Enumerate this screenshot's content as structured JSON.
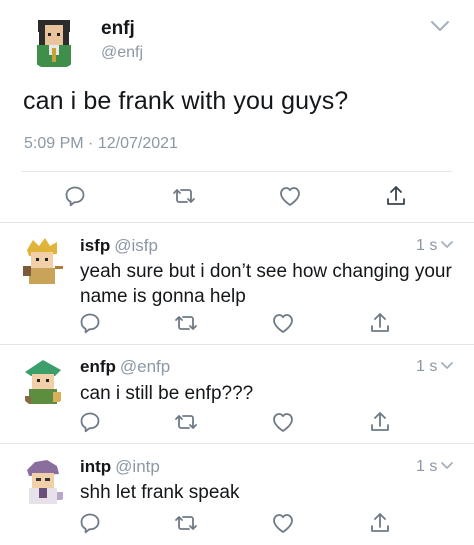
{
  "main_tweet": {
    "author_name": "enfj",
    "author_handle": "@enfj",
    "text": "can i be frank with you guys?",
    "time": "5:09 PM",
    "separator": "·",
    "date": "12/07/2021",
    "avatar_icon": "pixel-person-avatar",
    "menu_icon": "chevron-down-icon"
  },
  "actions": {
    "reply_icon": "reply-icon",
    "retweet_icon": "retweet-icon",
    "like_icon": "heart-icon",
    "share_icon": "share-icon"
  },
  "replies": [
    {
      "name": "isfp",
      "handle": "@isfp",
      "time": "1 s",
      "text_line1": "yeah sure but i don’t see how changing your",
      "text_line2": "name is gonna help",
      "avatar_icon": "adventurer-avatar"
    },
    {
      "name": "enfp",
      "handle": "@enfp",
      "time": "1 s",
      "text_line1": "can i still be enfp???",
      "avatar_icon": "campaigner-avatar"
    },
    {
      "name": "intp",
      "handle": "@intp",
      "time": "1 s",
      "text_line1": "shh let frank speak",
      "avatar_icon": "logician-avatar"
    }
  ],
  "colors": {
    "text": "#14171a",
    "secondary": "#8b98a5",
    "divider": "#e1e6ea"
  }
}
